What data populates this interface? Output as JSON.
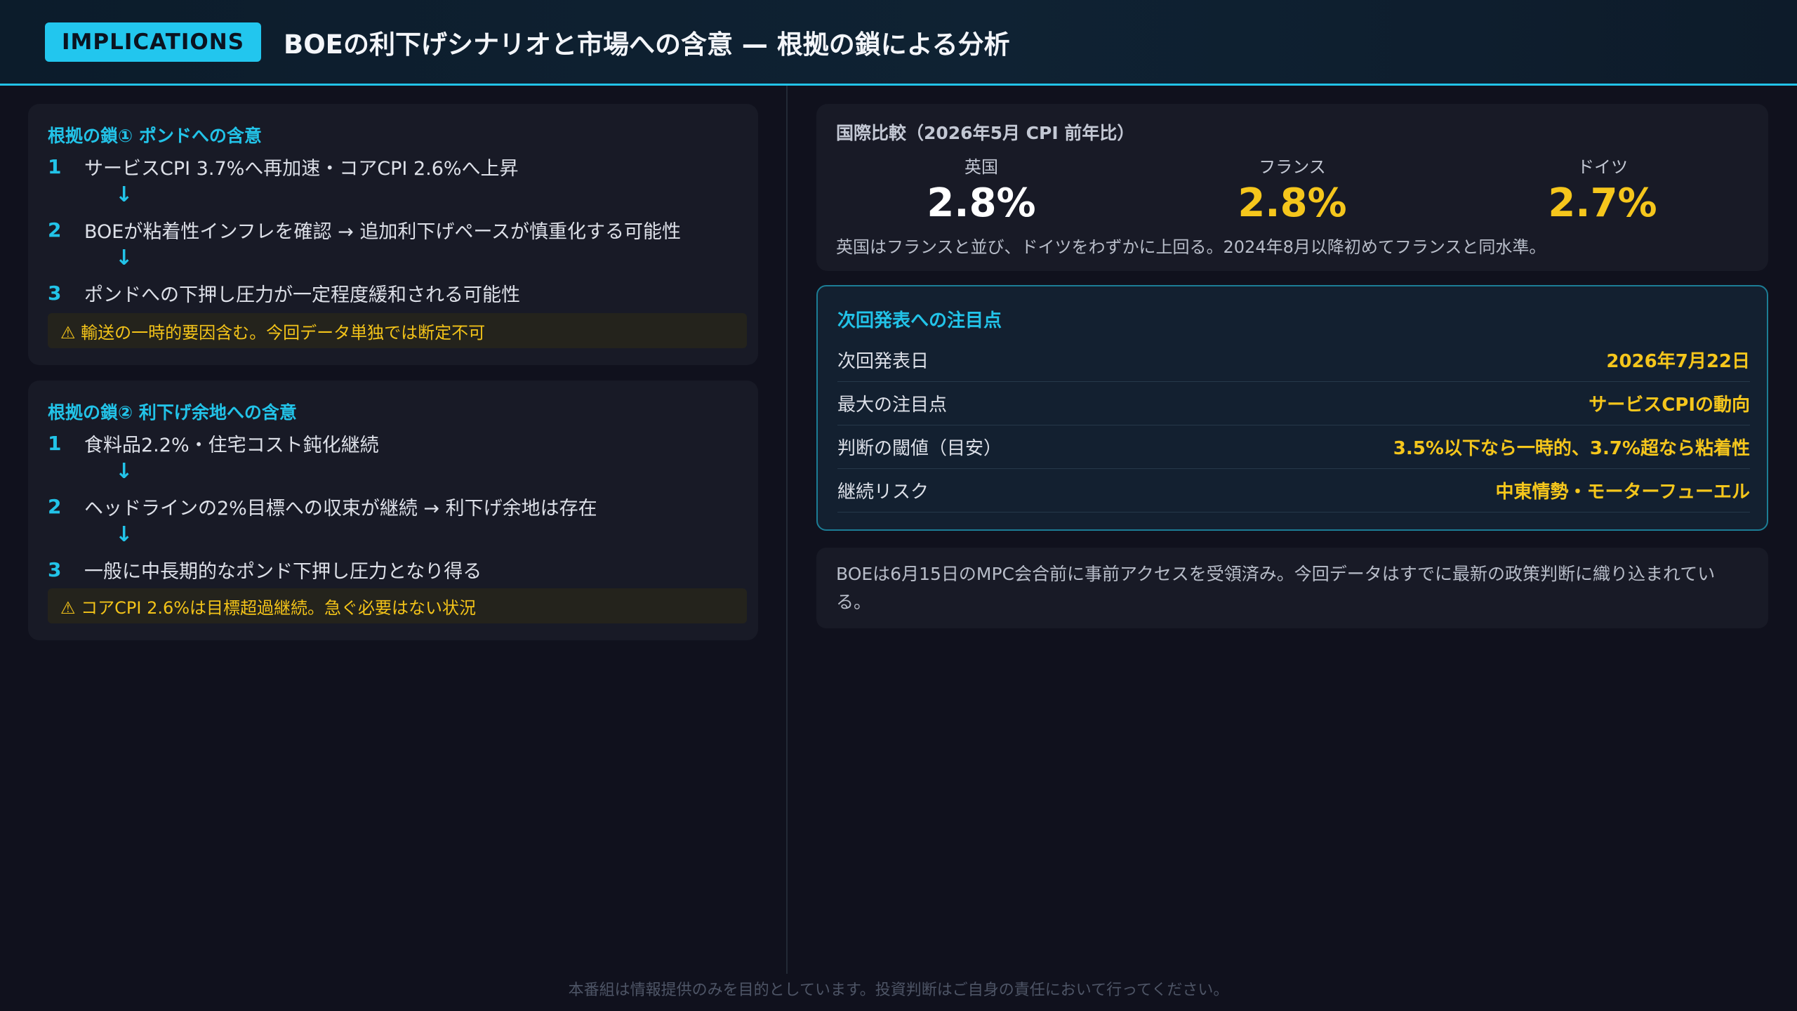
{
  "header": {
    "badge": "IMPLICATIONS",
    "title": "BOEの利下げシナリオと市場への含意 — 根拠の鎖による分析"
  },
  "chain1": {
    "title": "根拠の鎖① ポンドへの含意",
    "steps": [
      {
        "num": "1",
        "text": "サービスCPI 3.7%へ再加速・コアCPI 2.6%へ上昇"
      },
      {
        "num": "2",
        "text": "BOEが粘着性インフレを確認 → 追加利下げペースが慎重化する可能性"
      },
      {
        "num": "3",
        "text": "ポンドへの下押し圧力が一定程度緩和される可能性"
      }
    ],
    "arrow": "↓",
    "warning": "⚠ 輸送の一時的要因含む。今回データ単独では断定不可"
  },
  "chain2": {
    "title": "根拠の鎖② 利下げ余地への含意",
    "steps": [
      {
        "num": "1",
        "text": "食料品2.2%・住宅コスト鈍化継続"
      },
      {
        "num": "2",
        "text": "ヘッドラインの2%目標への収束が継続 → 利下げ余地は存在"
      },
      {
        "num": "3",
        "text": "一般に中長期的なポンド下押し圧力となり得る"
      }
    ],
    "arrow": "↓",
    "warning": "⚠ コアCPI 2.6%は目標超過継続。急ぐ必要はない状況"
  },
  "comparison": {
    "label": "国際比較（2026年5月 CPI 前年比）",
    "items": [
      {
        "country": "英国",
        "value": "2.8%",
        "color": "#ffffff"
      },
      {
        "country": "フランス",
        "value": "2.8%",
        "color": "#f5c61c"
      },
      {
        "country": "ドイツ",
        "value": "2.7%",
        "color": "#f5c61c"
      }
    ],
    "note": "英国はフランスと並び、ドイツをわずかに上回る。2024年8月以降初めてフランスと同水準。"
  },
  "next_release": {
    "title": "次回発表への注目点",
    "rows": [
      {
        "key": "次回発表日",
        "value": "2026年7月22日"
      },
      {
        "key": "最大の注目点",
        "value": "サービスCPIの動向"
      },
      {
        "key": "判断の閾値（目安）",
        "value": "3.5%以下なら一時的、3.7%超なら粘着性"
      },
      {
        "key": "継続リスク",
        "value": "中東情勢・モーターフューエル"
      }
    ]
  },
  "info": "BOEは6月15日のMPC会合前に事前アクセスを受領済み。今回データはすでに最新の政策判断に織り込まれている。",
  "footer": "本番組は情報提供のみを目的としています。投資判断はご自身の責任において行ってください。",
  "colors": {
    "accent": "#22c3e8",
    "highlight": "#f5c61c",
    "background": "#10111d"
  }
}
